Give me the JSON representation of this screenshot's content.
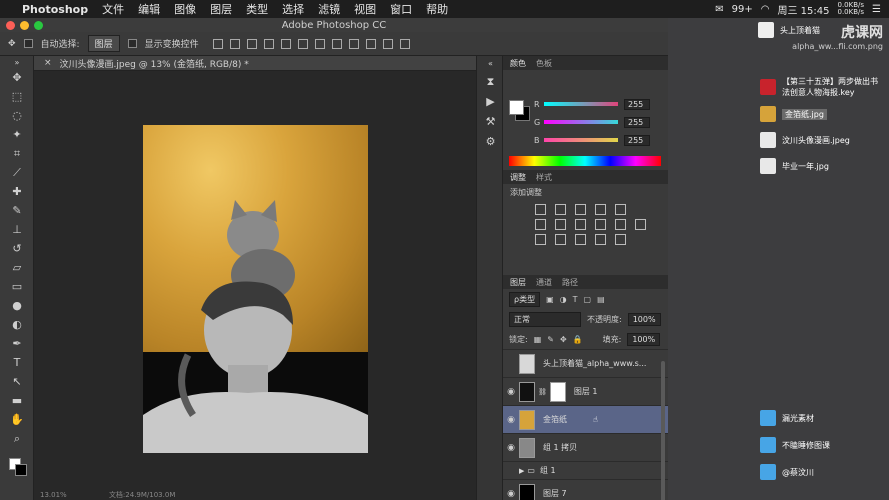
{
  "menubar": {
    "app_name": "Photoshop",
    "items": [
      "文件",
      "编辑",
      "图像",
      "图层",
      "类型",
      "选择",
      "滤镜",
      "视图",
      "窗口",
      "帮助"
    ],
    "badge": "99+",
    "clock": "周三 15:45",
    "net_up": "0.0KB/s",
    "net_down": "0.0KB/s"
  },
  "window": {
    "title": "Adobe Photoshop CC"
  },
  "options_bar": {
    "auto_select_label": "自动选择:",
    "auto_select_value": "图层",
    "show_transform_label": "显示变换控件"
  },
  "document": {
    "tab_title": "汶川头像漫画.jpeg @ 13% (金箔纸, RGB/8) *",
    "zoom": "13.01%",
    "doc_info": "文档:24.9M/103.0M"
  },
  "color_panel": {
    "tabs": [
      "颜色",
      "色板"
    ],
    "channels": [
      {
        "label": "R",
        "value": "255",
        "color": "#e0447a"
      },
      {
        "label": "G",
        "value": "255",
        "color": "#36d8d8"
      },
      {
        "label": "B",
        "value": "255",
        "color": "#e0d64a"
      }
    ]
  },
  "adjust_panel": {
    "tabs": [
      "调整",
      "样式"
    ],
    "title": "添加调整"
  },
  "layers_panel": {
    "tabs": [
      "图层",
      "通道",
      "路径"
    ],
    "filter_label": "ρ类型",
    "blend_mode": "正常",
    "opacity_label": "不透明度:",
    "opacity_value": "100%",
    "lock_label": "锁定:",
    "fill_label": "填充:",
    "fill_value": "100%",
    "layers": [
      {
        "name": "头上顶着猫_alpha_www.s...",
        "visible": false,
        "selected": false,
        "thumb": "#d8d8d8"
      },
      {
        "name": "图层 1",
        "visible": true,
        "selected": false,
        "thumb": "#111111"
      },
      {
        "name": "金箔纸",
        "visible": true,
        "selected": true,
        "thumb": "#d6a33a"
      },
      {
        "name": "组 1 拷贝",
        "visible": true,
        "selected": false,
        "thumb": "#888888"
      },
      {
        "name": "组 1",
        "visible": false,
        "selected": false,
        "thumb": ""
      },
      {
        "name": "图层 7",
        "visible": true,
        "selected": false,
        "thumb": "#000000"
      }
    ]
  },
  "desktop": {
    "watermark_line1": "虎课网",
    "watermark_line2": "alpha_ww...fli.com.png",
    "watermark_label": "头上顶着猫",
    "files": [
      {
        "name": "【第三十五弹】两步做出书法创意人物海报.key",
        "icon_color": "#c8232c"
      },
      {
        "name": "金箔纸.jpg",
        "icon_color": "#d6a33a"
      },
      {
        "name": "汶川头像漫画.jpeg",
        "icon_color": "#e8e8e8"
      },
      {
        "name": "毕业一年.jpg",
        "icon_color": "#e8e8e8"
      }
    ],
    "folders": [
      "漏光素材",
      "不瞌睡修图课",
      "@蔡汶川"
    ]
  }
}
